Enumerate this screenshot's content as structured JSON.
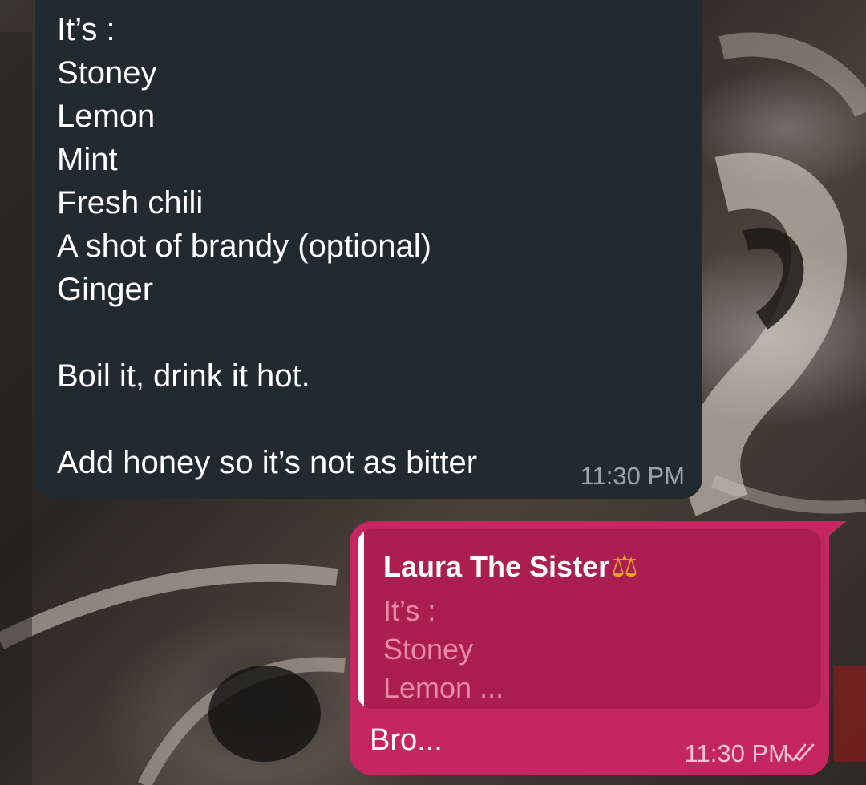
{
  "incoming_message": {
    "lines": [
      "It’s :",
      "Stoney",
      "Lemon",
      "Mint",
      "Fresh chili",
      "A shot of brandy (optional)",
      "Ginger",
      "",
      "Boil it, drink it hot.",
      "",
      "Add honey so it’s not as bitter"
    ],
    "time": "11:30 PM"
  },
  "outgoing_message": {
    "reply": {
      "sender": "Laura The Sister",
      "sender_emoji": "⚖",
      "preview_lines": [
        "It’s :",
        "Stoney",
        "Lemon ..."
      ]
    },
    "text": "Bro...",
    "time": "11:30 PM",
    "status_icon": "double-check-icon"
  },
  "colors": {
    "incoming_bubble": "#212a2f",
    "outgoing_bubble": "#c6265f",
    "reply_box": "#aa1f4f",
    "reply_text": "#e88aa9"
  }
}
